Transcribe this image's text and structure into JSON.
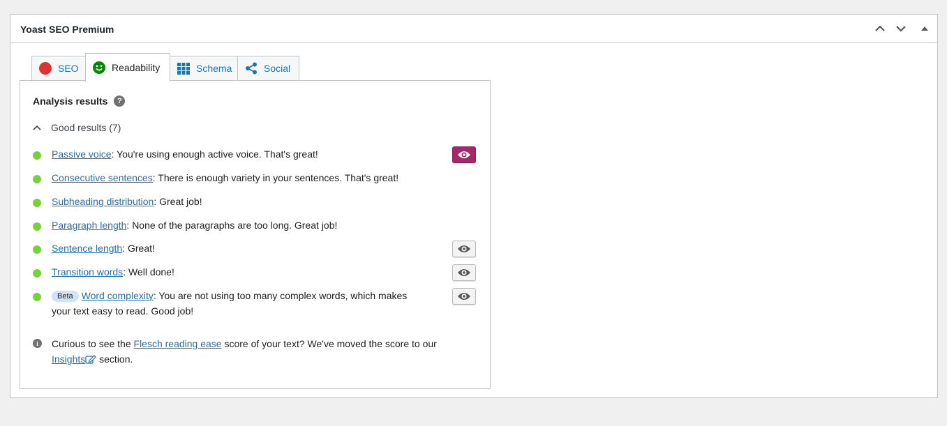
{
  "metabox": {
    "title": "Yoast SEO Premium"
  },
  "tabs": [
    {
      "label": "SEO"
    },
    {
      "label": "Readability"
    },
    {
      "label": "Schema"
    },
    {
      "label": "Social"
    }
  ],
  "analysis": {
    "heading": "Analysis results",
    "good_results_label": "Good results (7)",
    "results": [
      {
        "link": "Passive voice",
        "text": ": You're using enough active voice. That's great!"
      },
      {
        "link": "Consecutive sentences",
        "text": ": There is enough variety in your sentences. That's great!"
      },
      {
        "link": "Subheading distribution",
        "text": ": Great job!"
      },
      {
        "link": "Paragraph length",
        "text": ": None of the paragraphs are too long. Great job!"
      },
      {
        "link": "Sentence length",
        "text": ": Great!"
      },
      {
        "link": "Transition words",
        "text": ": Well done!"
      },
      {
        "badge": "Beta",
        "link": "Word complexity",
        "text": ": You are not using too many complex words, which makes",
        "text2": "your text easy to read. Good job!"
      }
    ],
    "info": {
      "before": "Curious to see the ",
      "link1": "Flesch reading ease",
      "middle": " score of your text? We've moved the score to our",
      "link2": "Insights",
      "after": " section."
    }
  },
  "colors": {
    "good_dot": "#7ad03a",
    "seo_dot": "#dc3232",
    "readability_face": "#008a00",
    "eye_active": "#a4286a",
    "link": "#2271b1"
  }
}
